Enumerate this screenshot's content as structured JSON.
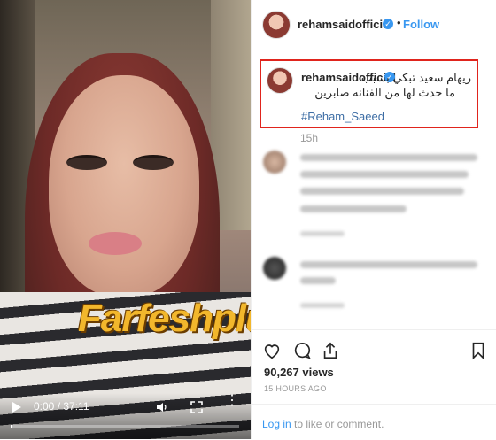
{
  "video": {
    "watermark": "Farfeshplus.com",
    "time": "0:00 / 37:11",
    "progress": 0.0,
    "play_icon": "play-icon",
    "volume_icon": "volume-icon",
    "fullscreen_icon": "fullscreen-icon",
    "more_icon": "more-vertical-icon"
  },
  "header": {
    "username": "rehamsaidofficial",
    "verified_glyph": "✓",
    "separator": "•",
    "follow_label": "Follow"
  },
  "caption": {
    "username": "rehamsaidofficial",
    "line1": "ريهام سعيد تبكي بسبب",
    "line2": "ما حدث لها من الفنانه صابرين",
    "hashtag": "#Reham_Saeed",
    "time": "15h"
  },
  "stats": {
    "views": "90,267 views",
    "posted": "15 HOURS AGO"
  },
  "login": {
    "link_label": "Log in",
    "rest_label": " to like or comment."
  },
  "colors": {
    "accent": "#3897f0",
    "highlight_border": "#e0241d",
    "hashtag": "#3e6ea5"
  }
}
